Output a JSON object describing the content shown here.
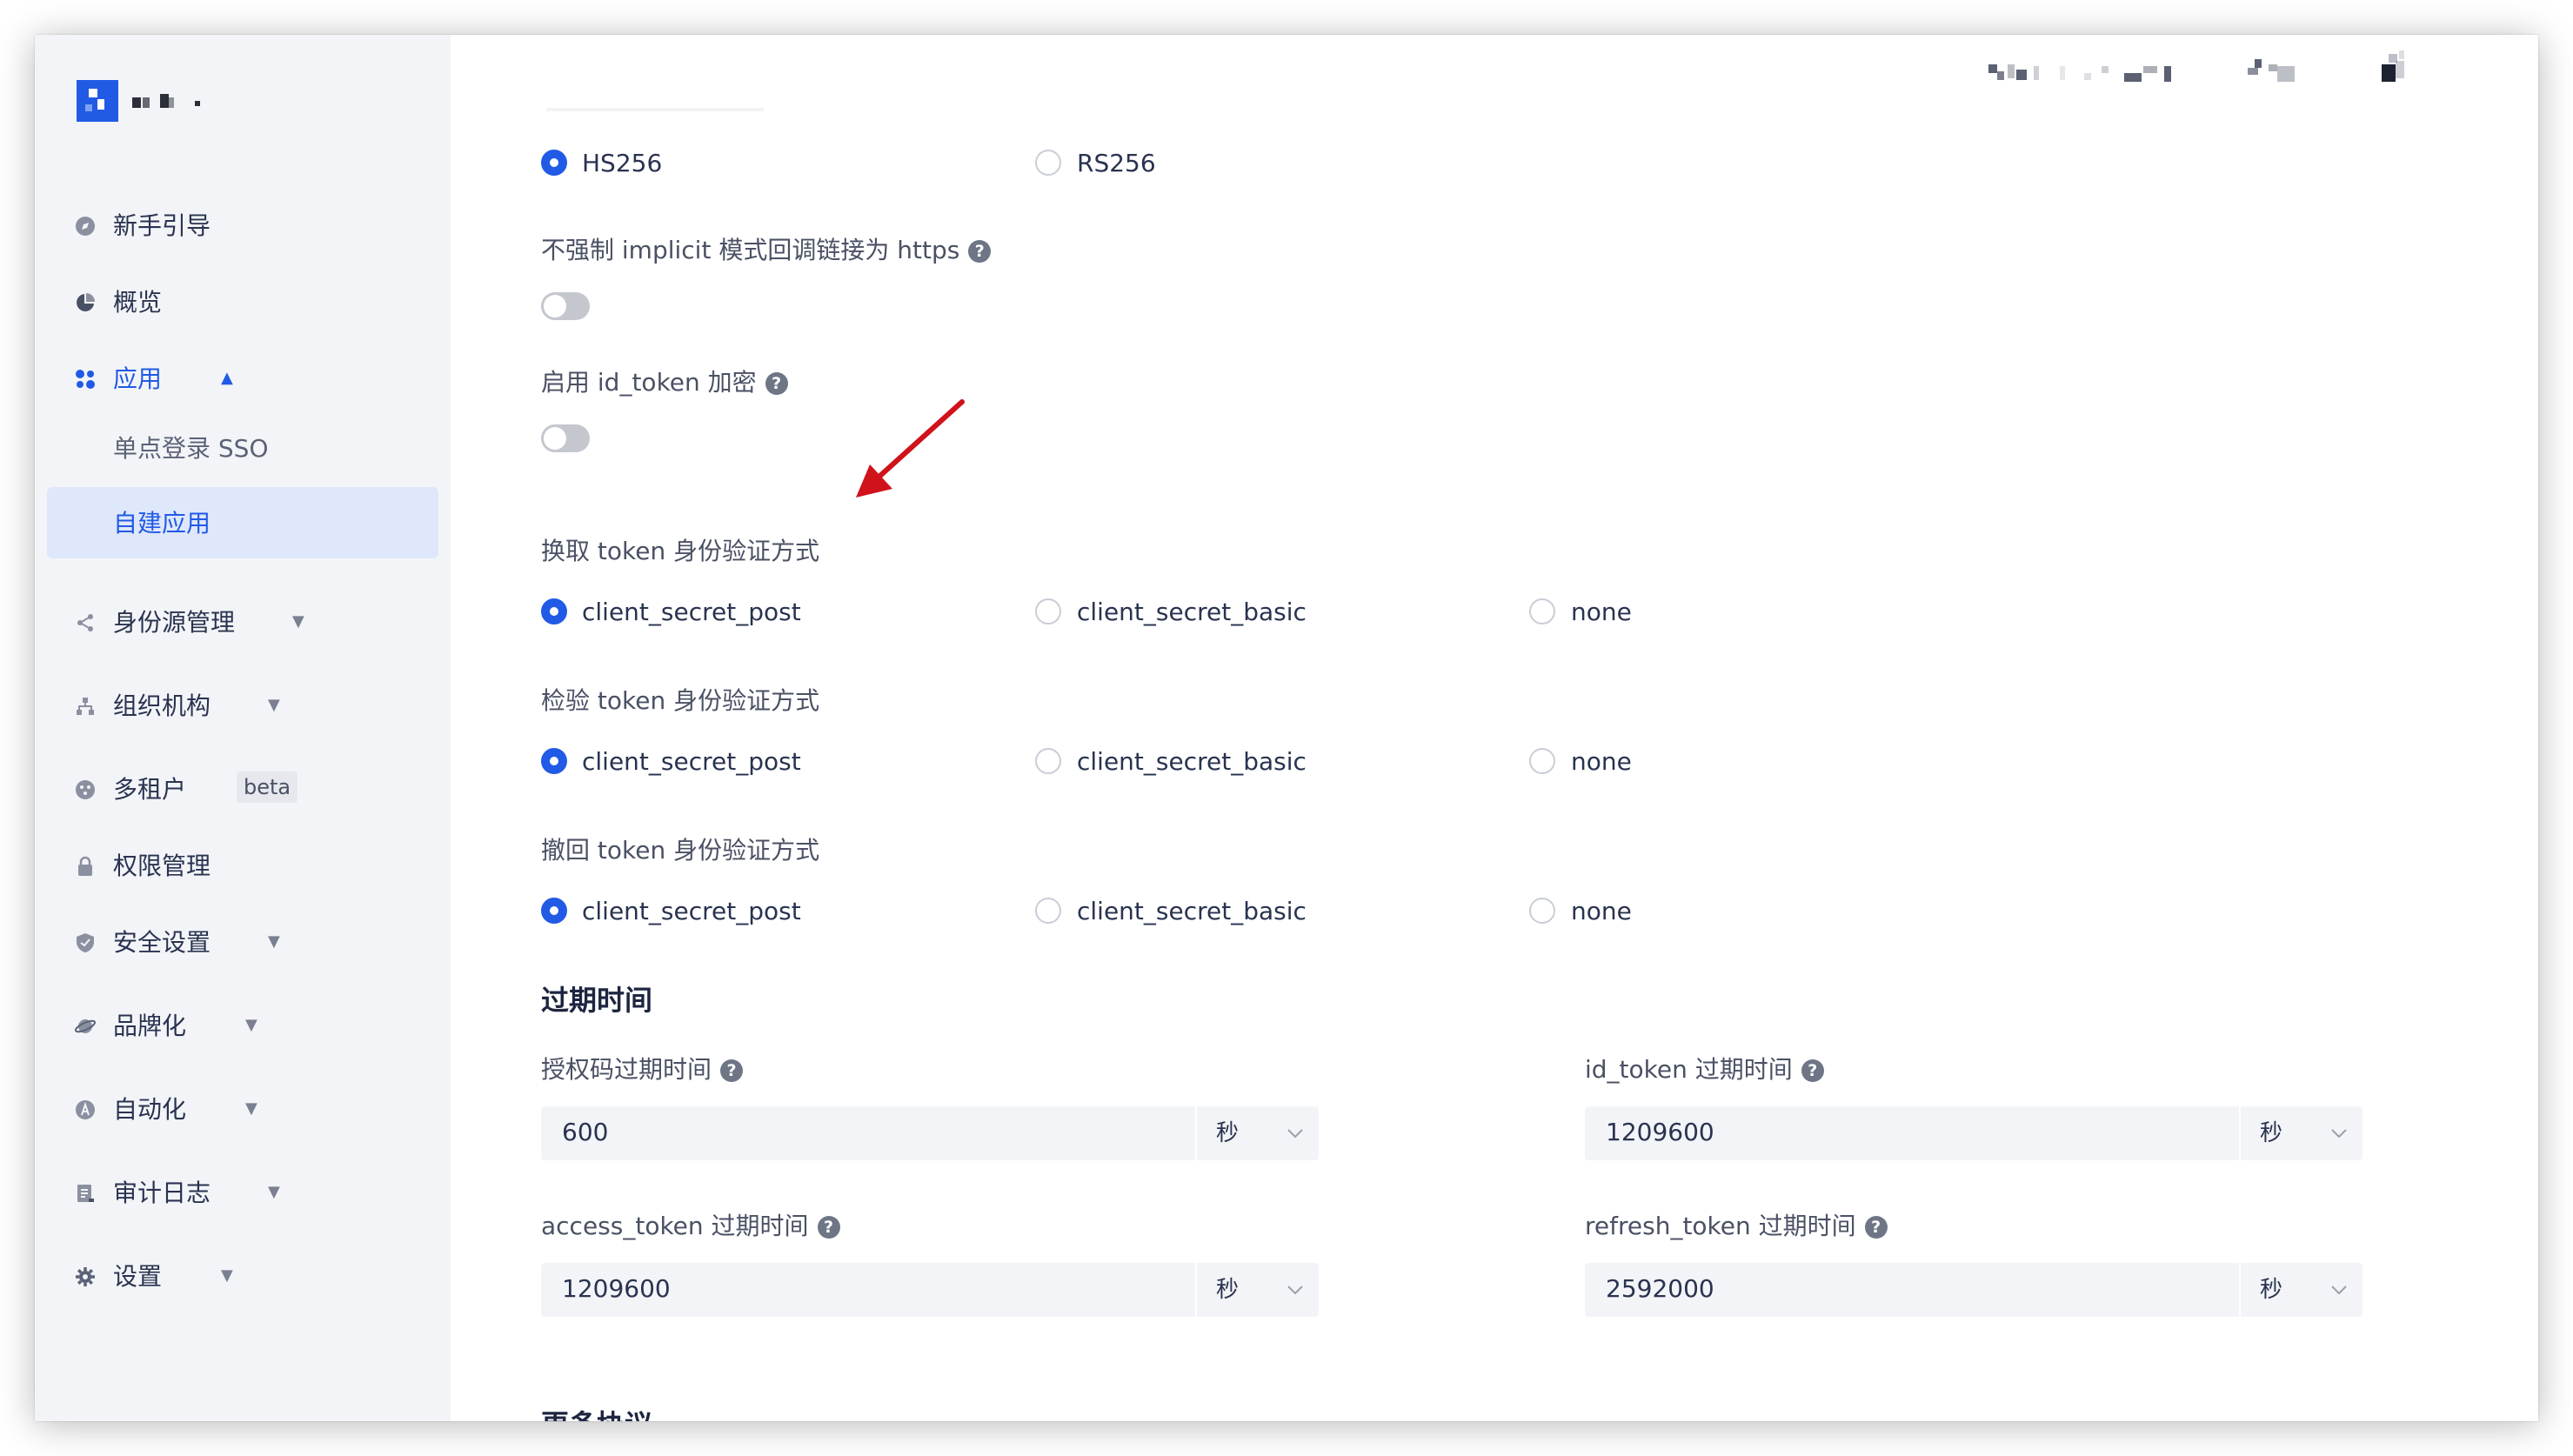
{
  "sidebar": {
    "nav": [
      {
        "label": "新手引导"
      },
      {
        "label": "概览"
      },
      {
        "label": "应用"
      },
      {
        "label": "单点登录 SSO"
      },
      {
        "label": "自建应用"
      },
      {
        "label": "身份源管理"
      },
      {
        "label": "组织机构"
      },
      {
        "label": "多租户",
        "badge": "beta"
      },
      {
        "label": "权限管理"
      },
      {
        "label": "安全设置"
      },
      {
        "label": "品牌化"
      },
      {
        "label": "自动化"
      },
      {
        "label": "审计日志"
      },
      {
        "label": "设置"
      }
    ]
  },
  "content": {
    "sign_alg": {
      "options": [
        "HS256",
        "RS256"
      ],
      "selected": "HS256"
    },
    "implicit_https": {
      "label": "不强制 implicit 模式回调链接为 https",
      "enabled": false
    },
    "id_token_encrypt": {
      "label": "启用 id_token 加密",
      "enabled": false
    },
    "token_exchange_auth": {
      "label": "换取 token 身份验证方式",
      "options": [
        "client_secret_post",
        "client_secret_basic",
        "none"
      ],
      "selected": "client_secret_post"
    },
    "token_introspect_auth": {
      "label": "检验 token 身份验证方式",
      "options": [
        "client_secret_post",
        "client_secret_basic",
        "none"
      ],
      "selected": "client_secret_post"
    },
    "token_revoke_auth": {
      "label": "撤回 token 身份验证方式",
      "options": [
        "client_secret_post",
        "client_secret_basic",
        "none"
      ],
      "selected": "client_secret_post"
    },
    "expiry": {
      "title": "过期时间",
      "fields": [
        {
          "label": "授权码过期时间",
          "value": "600",
          "unit": "秒"
        },
        {
          "label": "id_token 过期时间",
          "value": "1209600",
          "unit": "秒"
        },
        {
          "label": "access_token 过期时间",
          "value": "1209600",
          "unit": "秒"
        },
        {
          "label": "refresh_token 过期时间",
          "value": "2592000",
          "unit": "秒"
        }
      ]
    },
    "more_protocols": {
      "title": "更多协议"
    },
    "help_symbol": "?"
  },
  "colors": {
    "accent": "#215ae5",
    "annotation_arrow": "#d0121b",
    "sidebar_bg": "#f3f4f7"
  }
}
